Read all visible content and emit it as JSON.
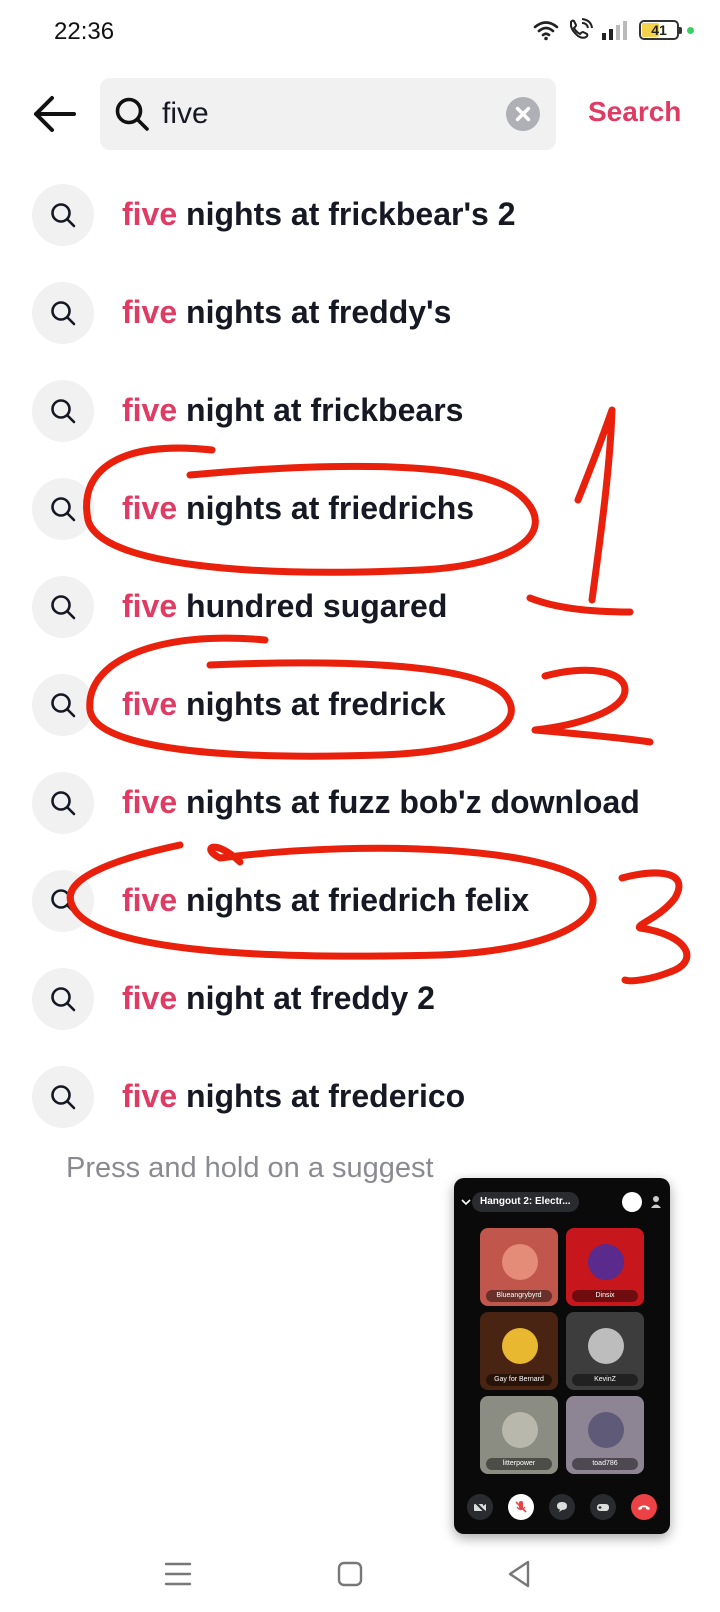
{
  "status_bar": {
    "time": "22:36",
    "battery_level": "41",
    "icons": [
      "wifi-icon",
      "wifi-call-icon",
      "signal-icon",
      "battery-icon"
    ]
  },
  "search": {
    "back_icon": "arrow-left-icon",
    "query": "five",
    "search_label": "Search",
    "accent_color": "#e03b62"
  },
  "suggestions": [
    {
      "highlight": "five",
      "rest": " nights at frickbear's 2"
    },
    {
      "highlight": "five",
      "rest": " nights at freddy's"
    },
    {
      "highlight": "five",
      "rest": " night at frickbears"
    },
    {
      "highlight": "five",
      "rest": " nights at friedrichs"
    },
    {
      "highlight": "five",
      "rest": " hundred sugared"
    },
    {
      "highlight": "five",
      "rest": " nights at fredrick"
    },
    {
      "highlight": "five",
      "rest": " nights at fuzz bob'z download"
    },
    {
      "highlight": "five",
      "rest": " nights at friedrich felix"
    },
    {
      "highlight": "five",
      "rest": " night at freddy 2"
    },
    {
      "highlight": "five",
      "rest": " nights at frederico"
    }
  ],
  "hint": "Press and hold on a suggest",
  "annotations": {
    "labels": [
      "1",
      "2",
      "3"
    ],
    "color": "#e8200c"
  },
  "pip": {
    "title": "Hangout 2: Electr...",
    "participants": [
      {
        "name": "Blueangrybyrd",
        "bg": "#c0564c"
      },
      {
        "name": "Dinsix",
        "bg": "#c8161d"
      },
      {
        "name": "Gay for Bernard",
        "bg": "#4a2412"
      },
      {
        "name": "KevinZ",
        "bg": "#3d3d3d"
      },
      {
        "name": "litterpower",
        "bg": "#8c8d82"
      },
      {
        "name": "toad786",
        "bg": "#8d8494"
      }
    ]
  },
  "nav": [
    "menu-icon",
    "home-square-icon",
    "back-triangle-icon"
  ]
}
